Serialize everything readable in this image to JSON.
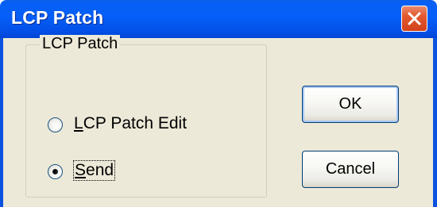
{
  "window": {
    "title": "LCP Patch"
  },
  "group": {
    "legend": "LCP Patch",
    "options": [
      {
        "label_accel": "L",
        "label_rest": "CP Patch Edit",
        "selected": false
      },
      {
        "label_accel": "S",
        "label_rest": "end",
        "selected": true
      }
    ]
  },
  "buttons": {
    "ok": "OK",
    "cancel": "Cancel"
  },
  "icons": {
    "close": "close-icon"
  },
  "colors": {
    "titlebar": "#055ff8",
    "dialog_bg": "#ece9d8",
    "close_button": "#e2582f"
  }
}
